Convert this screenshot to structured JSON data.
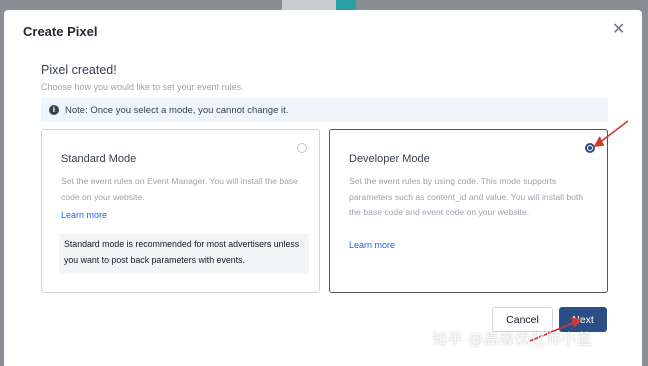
{
  "colors": {
    "accent": "#2c4e86",
    "link": "#2563eb",
    "annotation": "#d03a2e"
  },
  "modal": {
    "title": "Create Pixel",
    "close_icon": "close-icon",
    "heading": "Pixel created!",
    "subheading": "Choose how you would like to set your event rules.",
    "note": "Note: Once you select a mode, you cannot change it."
  },
  "modes": {
    "standard": {
      "title": "Standard Mode",
      "description": "Set the event rules on Event Manager. You will install the base code on your website.",
      "link": "Learn more",
      "note": "Standard mode is recommended for most advertisers unless you want to post back parameters with events.",
      "selected": false
    },
    "developer": {
      "title": "Developer Mode",
      "description": "Set the event rules by using code. This mode supports parameters such as content_id and value. You will install both the base code and event code on your website.",
      "link": "Learn more",
      "selected": true
    }
  },
  "footer": {
    "cancel": "Cancel",
    "next": "Next"
  },
  "watermark": "知乎 @高级优化师小蓝"
}
